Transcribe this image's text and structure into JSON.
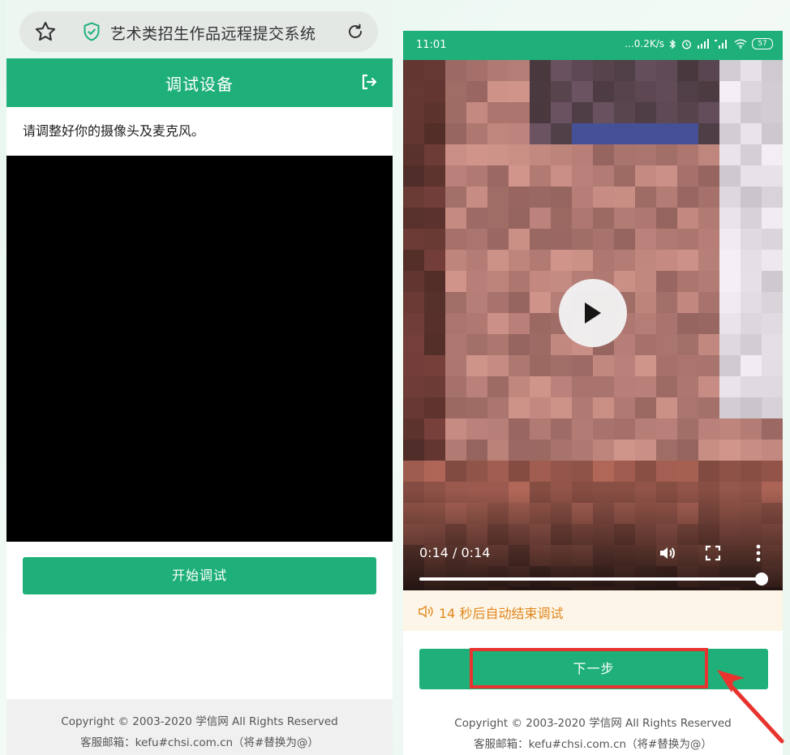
{
  "left_screen": {
    "browser": {
      "page_title": "艺术类招生作品远程提交系统",
      "star_icon": "star-outline-icon",
      "shield_icon": "shield-check-icon",
      "refresh_icon": "refresh-icon"
    },
    "header": {
      "title": "调试设备",
      "exit_icon": "exit-icon"
    },
    "instruction": "请调整好你的摄像头及麦克风。",
    "start_button_label": "开始调试",
    "footer": {
      "copyright": "Copyright © 2003-2020 学信网 All Rights Reserved",
      "contact": "客服邮箱：kefu#chsi.com.cn（将#替换为@）"
    }
  },
  "right_screen": {
    "status_bar": {
      "time": "11:01",
      "network_speed": "...0.2K/s",
      "battery": "57"
    },
    "video": {
      "time_display": "0:14 / 0:14",
      "progress": 1.0
    },
    "countdown_text": "14 秒后自动结束调试",
    "next_button_label": "下一步",
    "footer": {
      "copyright": "Copyright © 2003-2020 学信网 All Rights Reserved",
      "contact": "客服邮箱：kefu#chsi.com.cn（将#替换为@）"
    }
  },
  "colors": {
    "brand_green": "#1fb07a",
    "countdown_orange": "#e0861c",
    "highlight_red": "#e8332e"
  }
}
